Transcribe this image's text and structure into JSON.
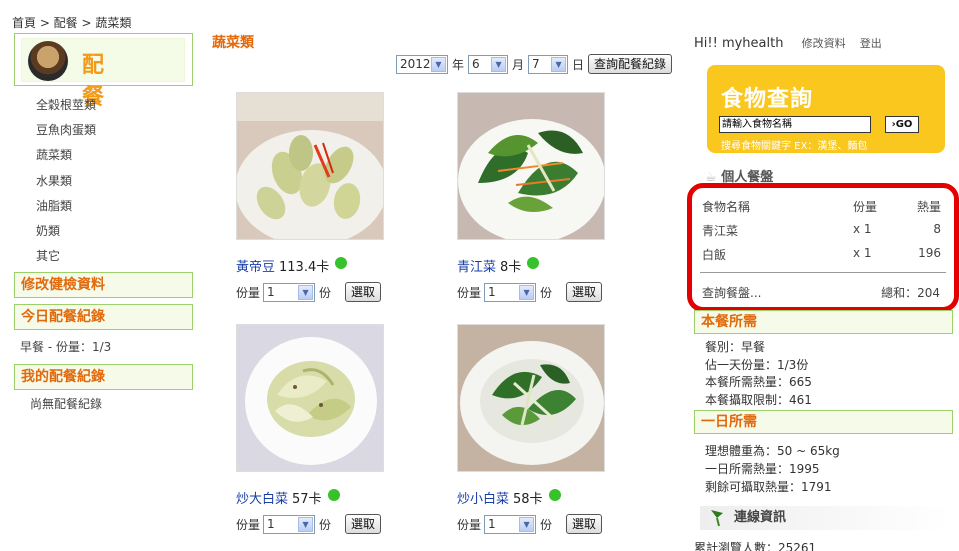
{
  "breadcrumb": "首頁 > 配餐 > 蔬菜類",
  "logo": {
    "text": "配 餐"
  },
  "categories": [
    "全穀根莖類",
    "豆魚肉蛋類",
    "蔬菜類",
    "水果類",
    "油脂類",
    "奶類",
    "其它"
  ],
  "left": {
    "edit_health": "修改健檢資料",
    "today_log": "今日配餐紀錄",
    "today_log_detail": "早餐 - 份量：1/3",
    "my_log": "我的配餐紀錄",
    "my_log_empty": "尚無配餐紀錄"
  },
  "main": {
    "title": "蔬菜類",
    "date": {
      "year": "2012",
      "year_unit": "年",
      "month": "6",
      "month_unit": "月",
      "day": "7",
      "day_unit": "日"
    },
    "query_button": "查詢配餐紀錄",
    "qty_label": "份量",
    "qty_unit": "份",
    "select_button": "選取",
    "foods": [
      {
        "name": "黃帝豆",
        "kcal": "113.4卡",
        "qty": "1",
        "status_color": "#37c22b"
      },
      {
        "name": "青江菜",
        "kcal": "8卡",
        "qty": "1",
        "status_color": "#37c22b"
      },
      {
        "name": "炒大白菜",
        "kcal": "57卡",
        "qty": "1",
        "status_color": "#37c22b"
      },
      {
        "name": "炒小白菜",
        "kcal": "58卡",
        "qty": "1",
        "status_color": "#37c22b"
      }
    ]
  },
  "header": {
    "greeting": "Hi!! myhealth",
    "edit_profile": "修改資料",
    "logout": "登出"
  },
  "search": {
    "title": "食物查詢",
    "placeholder": "請輸入食物名稱",
    "go": "GO",
    "hint": "搜尋食物關鍵字 EX：漢堡、麵包"
  },
  "meal": {
    "heading": "個人餐盤",
    "columns": [
      "食物名稱",
      "份量",
      "熱量"
    ],
    "rows": [
      {
        "name": "青江菜",
        "qty": "x 1",
        "kcal": "8"
      },
      {
        "name": "白飯",
        "qty": "x 1",
        "kcal": "196"
      }
    ],
    "query_plate": "查詢餐盤...",
    "total": "總和：204"
  },
  "needs": {
    "meal_heading": "本餐所需",
    "meal_type": "餐別：早餐",
    "day_portion": "佔一天份量：1/3份",
    "meal_kcal": "本餐所需熱量：665",
    "meal_limit": "本餐攝取限制：461",
    "day_heading": "一日所需",
    "ideal_weight": "理想體重為：50 ~ 65kg",
    "day_kcal": "一日所需熱量：1995",
    "remaining": "剩餘可攝取熱量：1791"
  },
  "connection": {
    "heading": "連線資訊",
    "visits": "累計瀏覽人數：25261"
  },
  "colors": {
    "accent_orange": "#e26a0c",
    "green_border": "#9bd06a",
    "search_yellow": "#fac71f",
    "highlight_red": "#e40000",
    "status_green": "#37c22b"
  }
}
